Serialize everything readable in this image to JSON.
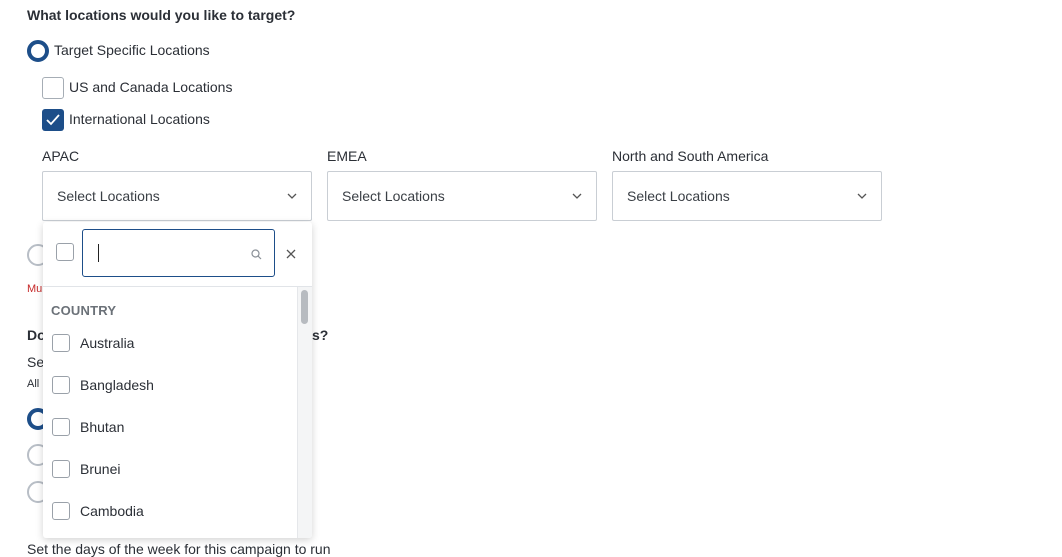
{
  "question": "What locations would you like to target?",
  "target_option": {
    "label": "Target Specific Locations",
    "selected": true
  },
  "location_types": [
    {
      "label": "US and Canada Locations",
      "checked": false
    },
    {
      "label": "International Locations",
      "checked": true
    }
  ],
  "regions": [
    {
      "label": "APAC",
      "placeholder": "Select Locations"
    },
    {
      "label": "EMEA",
      "placeholder": "Select Locations"
    },
    {
      "label": "North and South America",
      "placeholder": "Select Locations"
    }
  ],
  "dropdown": {
    "search_value": "",
    "group_header": "COUNTRY",
    "options": [
      "Australia",
      "Bangladesh",
      "Bhutan",
      "Brunei",
      "Cambodia"
    ]
  },
  "background": {
    "error_fragment": "Mu",
    "question2_start": "Do",
    "question2_end": "s?",
    "sub_start": "Se",
    "sub2_start": "All",
    "footer_text": "Set the days of the week for this campaign to run"
  }
}
